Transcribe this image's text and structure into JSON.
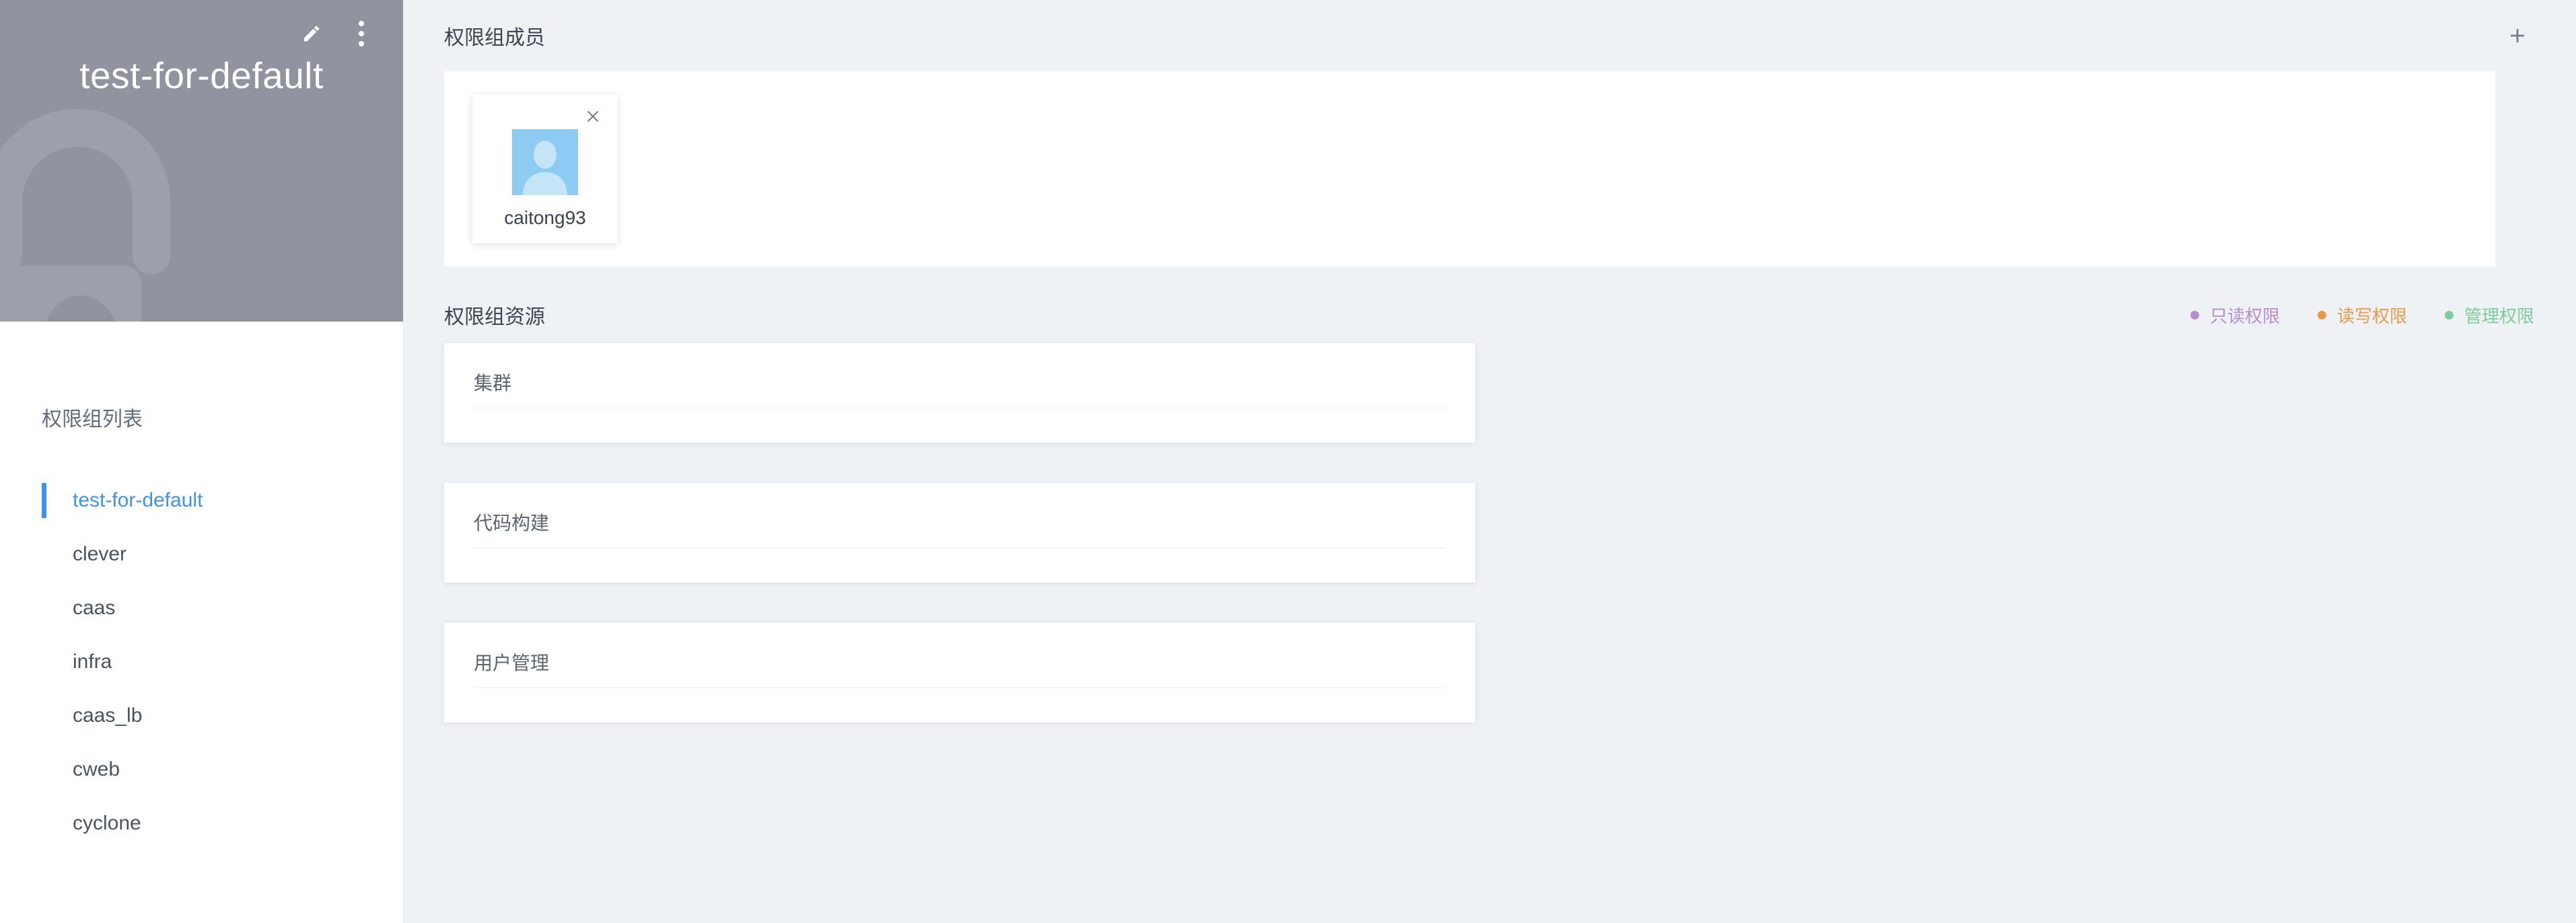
{
  "sidebar": {
    "header": {
      "title": "test-for-default",
      "edit_icon": "pencil-icon",
      "menu_icon": "vertical-dots-icon",
      "watermark_icon": "lock-icon"
    },
    "list_title": "权限组列表",
    "items": [
      {
        "label": "test-for-default",
        "active": true
      },
      {
        "label": "clever",
        "active": false
      },
      {
        "label": "caas",
        "active": false
      },
      {
        "label": "infra",
        "active": false
      },
      {
        "label": "caas_lb",
        "active": false
      },
      {
        "label": "cweb",
        "active": false
      },
      {
        "label": "cyclone",
        "active": false
      }
    ]
  },
  "members": {
    "title": "权限组成员",
    "add_icon": "plus-icon",
    "list": [
      {
        "name": "caitong93",
        "avatar_icon": "user-avatar-icon",
        "remove_icon": "close-icon"
      }
    ]
  },
  "resources": {
    "title": "权限组资源",
    "legend": [
      {
        "label": "只读权限",
        "color": "#b68ecb"
      },
      {
        "label": "读写权限",
        "color": "#e79a4c"
      },
      {
        "label": "管理权限",
        "color": "#7ecaa1"
      }
    ],
    "cards": [
      {
        "title": "集群"
      },
      {
        "title": "代码构建"
      },
      {
        "title": "用户管理"
      }
    ]
  },
  "colors": {
    "accent": "#3f92f0",
    "sidebar_header_bg": "#8f949e",
    "main_bg": "#eef2f5",
    "avatar_bg": "#8ecbf3"
  }
}
